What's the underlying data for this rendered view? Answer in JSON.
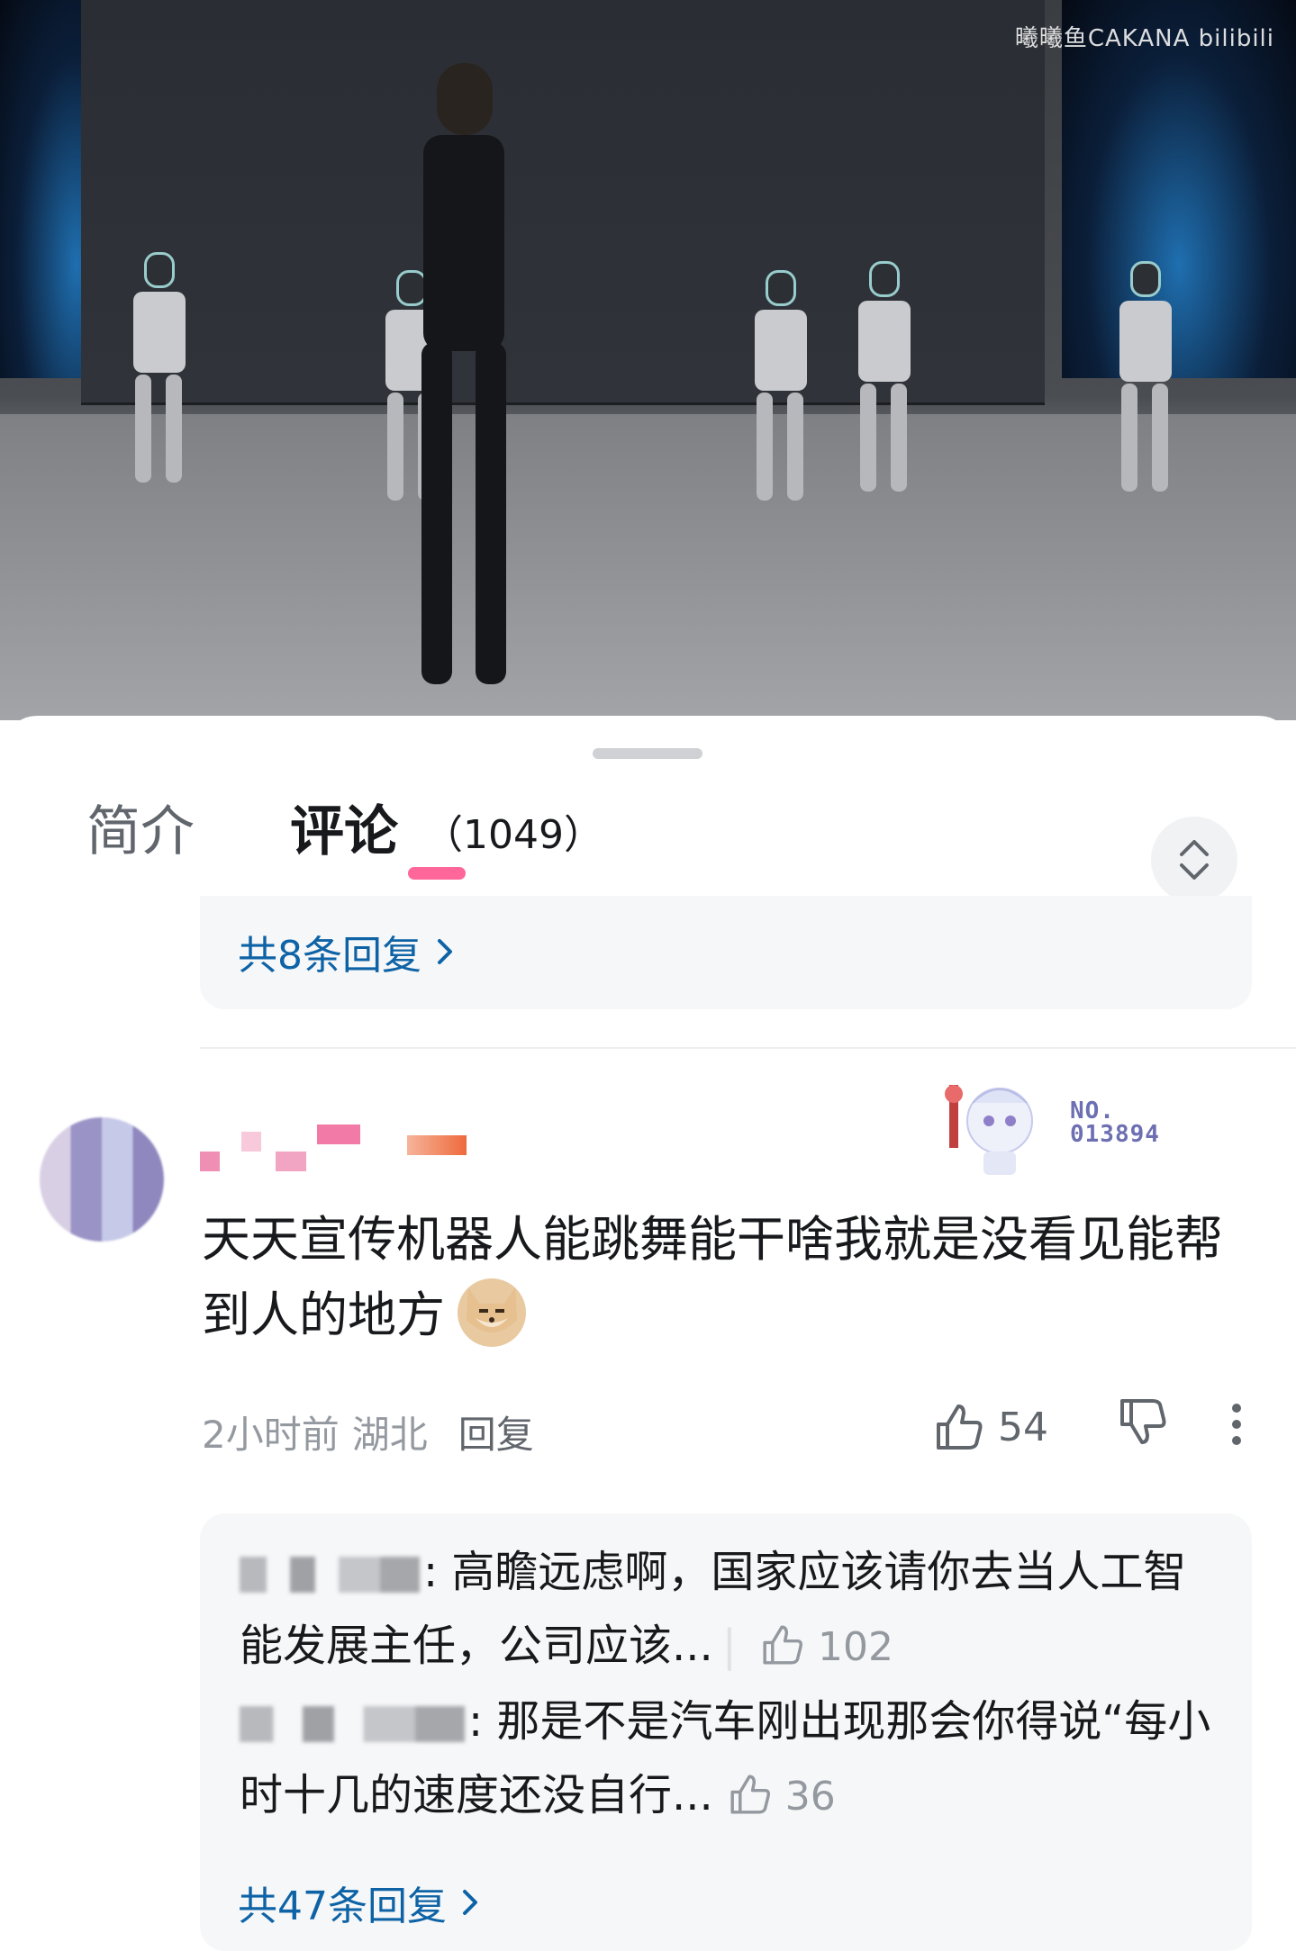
{
  "video": {
    "watermark": "曦曦鱼CAKANA bilibili"
  },
  "tabs": {
    "intro_label": "简介",
    "comments_label": "评论",
    "comments_count": "（1049）"
  },
  "prev_comment": {
    "reply_link": "共8条回复"
  },
  "comment": {
    "badge_label": "NO.\n013894",
    "text": "天天宣传机器人能跳舞能干啥我就是没看见能帮到人的地方",
    "time": "2小时前",
    "location": "湖北",
    "reply_label": "回复",
    "likes": "54"
  },
  "replies": [
    {
      "text": ": 高瞻远虑啊，国家应该请你去当人工智能发展主任，公司应该...",
      "likes": "102"
    },
    {
      "text": ": 那是不是汽车刚出现那会你得说“每小时十几的速度还没自行...",
      "likes": "36"
    }
  ],
  "replies_link": "共47条回复",
  "colors": {
    "accent_pink": "#ff6699",
    "link_blue": "#0e63a6",
    "muted_text": "#9499a0"
  }
}
